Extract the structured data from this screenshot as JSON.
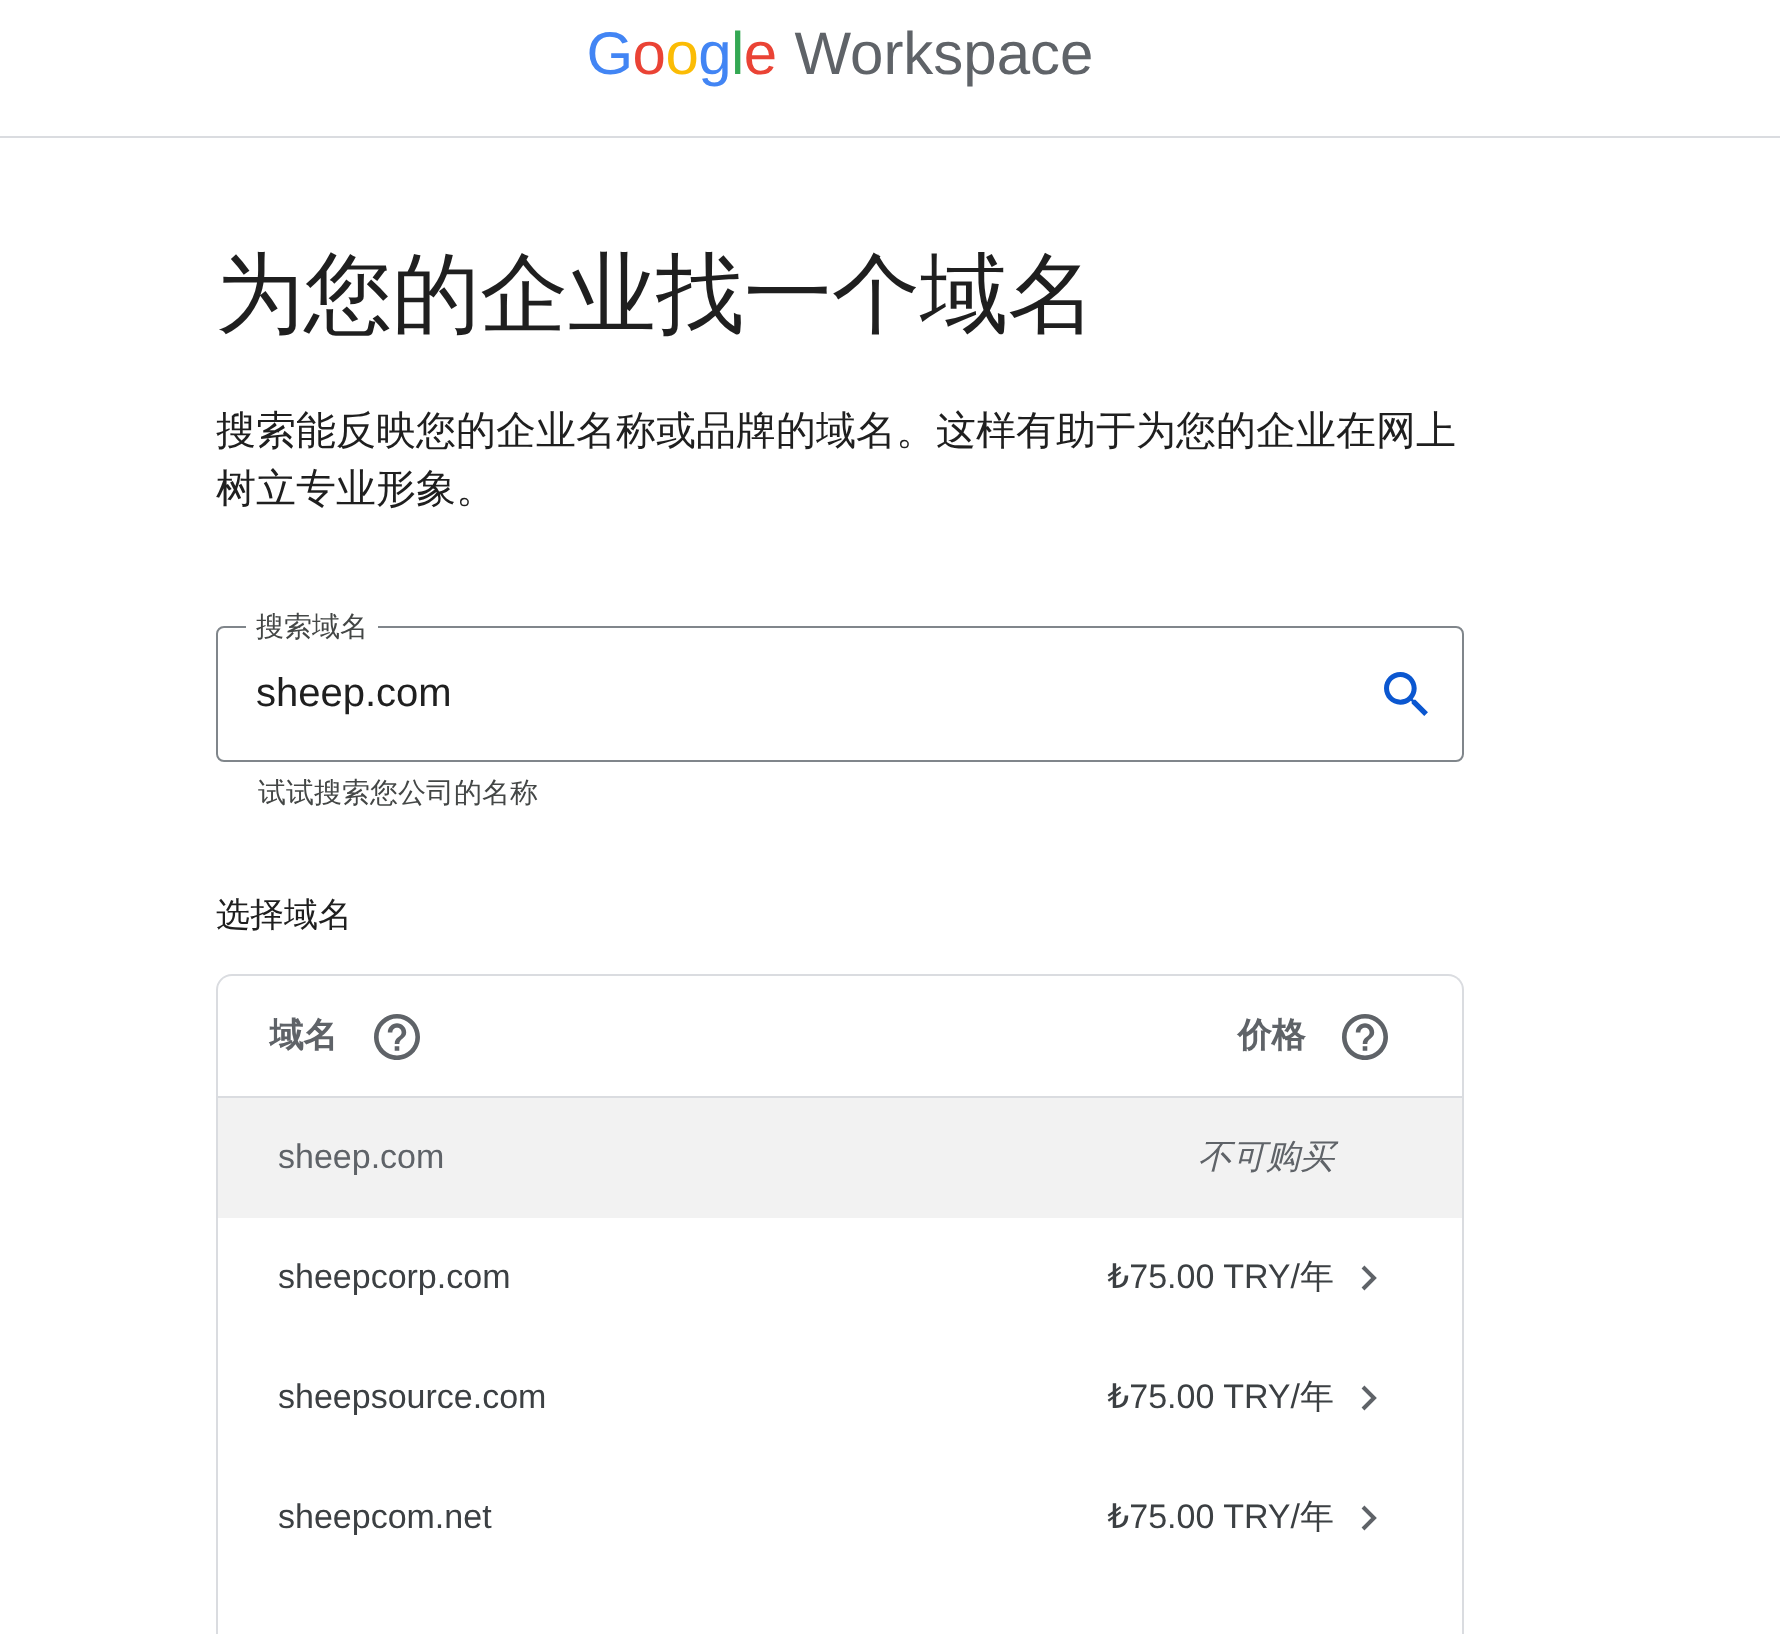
{
  "header": {
    "logo": {
      "brand": "Google",
      "product": "Workspace"
    }
  },
  "intro": {
    "title": "为您的企业找一个域名",
    "description": "搜索能反映您的企业名称或品牌的域名。这样有助于为您的企业在网上树立专业形象。"
  },
  "search": {
    "label": "搜索域名",
    "value": "sheep.com",
    "helper": "试试搜索您公司的名称"
  },
  "results": {
    "heading": "选择域名",
    "columns": [
      {
        "label": "域名"
      },
      {
        "label": "价格"
      }
    ],
    "rows": [
      {
        "domain": "sheep.com",
        "price": "不可购买",
        "available": false
      },
      {
        "domain": "sheepcorp.com",
        "price": "₺75.00 TRY/年",
        "available": true
      },
      {
        "domain": "sheepsource.com",
        "price": "₺75.00 TRY/年",
        "available": true
      },
      {
        "domain": "sheepcom.net",
        "price": "₺75.00 TRY/年",
        "available": true
      }
    ]
  }
}
